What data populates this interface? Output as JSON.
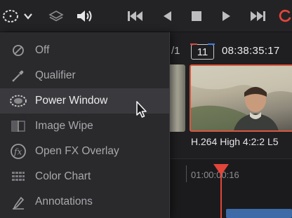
{
  "toolbar": {
    "icons": [
      "window-mode-icon",
      "chevron-down-icon",
      "layers-icon",
      "speaker-icon",
      "skip-to-start-icon",
      "step-back-icon",
      "stop-icon",
      "play-icon",
      "skip-to-end-icon",
      "loop-icon"
    ]
  },
  "viewer": {
    "clip_index_suffix": "/1",
    "clip_number": "11",
    "timecode": "08:38:35:17",
    "codec_label": "H.264 High 4:2:2 L5",
    "timeline_ruler_time": "01:00:00:16",
    "colors": {
      "playhead": "#e2453a",
      "selected_clip_border": "#d9583f"
    }
  },
  "menu": {
    "items": [
      {
        "label": "Off",
        "icon": "circle-slash-icon",
        "selected": false
      },
      {
        "label": "Qualifier",
        "icon": "eyedropper-icon",
        "selected": false
      },
      {
        "label": "Power Window",
        "icon": "power-window-icon",
        "selected": true
      },
      {
        "label": "Image Wipe",
        "icon": "image-wipe-icon",
        "selected": false
      },
      {
        "label": "Open FX Overlay",
        "icon": "fx-icon",
        "selected": false
      },
      {
        "label": "Color Chart",
        "icon": "color-chart-icon",
        "selected": false
      },
      {
        "label": "Annotations",
        "icon": "pen-icon",
        "selected": false
      }
    ]
  }
}
